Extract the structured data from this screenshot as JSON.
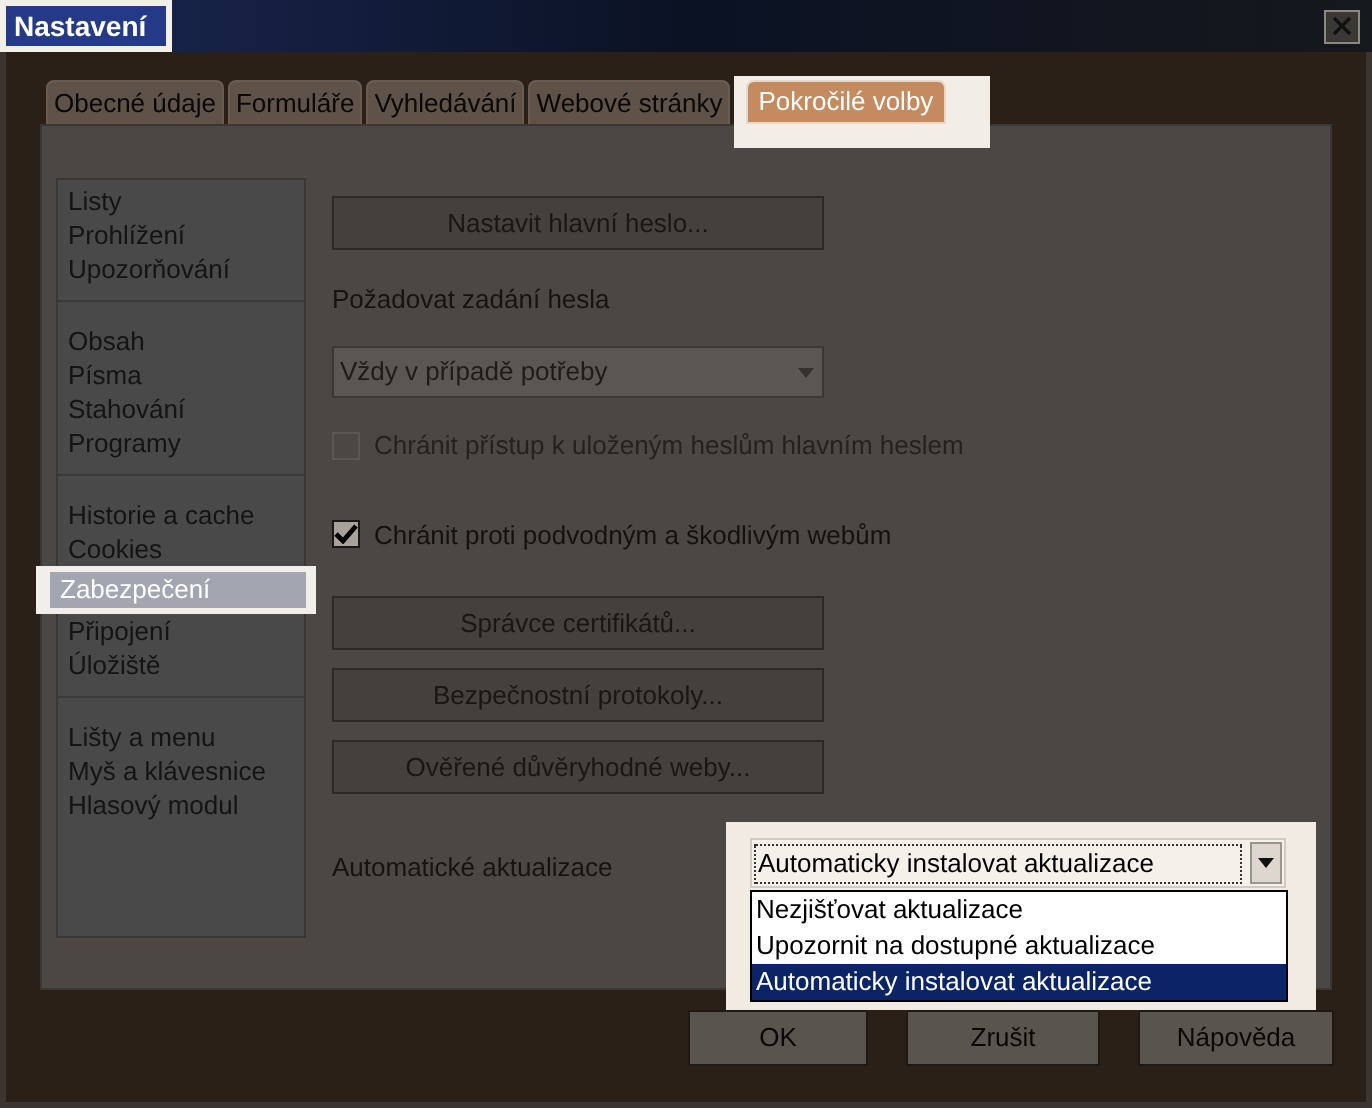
{
  "window": {
    "title": "Nastavení",
    "highlighted": true
  },
  "tabs": [
    {
      "label": "Obecné údaje",
      "selected": false
    },
    {
      "label": "Formuláře",
      "selected": false
    },
    {
      "label": "Vyhledávání",
      "selected": false
    },
    {
      "label": "Webové stránky",
      "selected": false
    },
    {
      "label": "Pokročilé volby",
      "selected": true
    }
  ],
  "sidebar": {
    "groups": [
      {
        "items": [
          {
            "label": "Listy",
            "selected": false
          },
          {
            "label": "Prohlížení",
            "selected": false
          },
          {
            "label": "Upozorňování",
            "selected": false
          }
        ]
      },
      {
        "items": [
          {
            "label": "Obsah",
            "selected": false
          },
          {
            "label": "Písma",
            "selected": false
          },
          {
            "label": "Stahování",
            "selected": false
          },
          {
            "label": "Programy",
            "selected": false
          }
        ]
      },
      {
        "items": [
          {
            "label": "Historie a cache",
            "selected": false
          },
          {
            "label": "Cookies",
            "selected": false
          },
          {
            "label": "Zabezpečení",
            "selected": true
          },
          {
            "label": "Připojení",
            "selected": false
          },
          {
            "label": "Úložiště",
            "selected": false
          }
        ]
      },
      {
        "items": [
          {
            "label": "Lišty a menu",
            "selected": false
          },
          {
            "label": "Myš a klávesnice",
            "selected": false
          },
          {
            "label": "Hlasový modul",
            "selected": false
          }
        ]
      }
    ]
  },
  "security": {
    "master_password_button": "Nastavit hlavní heslo...",
    "require_password_label": "Požadovat zadání hesla",
    "require_password_select": {
      "value": "Vždy v případě potřeby",
      "disabled": true
    },
    "checkboxes": [
      {
        "label": "Chránit přístup k uloženým heslům hlavním heslem",
        "checked": false,
        "disabled": true
      },
      {
        "label": "Chránit proti podvodným a škodlivým webům",
        "checked": true,
        "disabled": false
      }
    ],
    "buttons": [
      "Správce certifikátů...",
      "Bezpečnostní protokoly...",
      "Ověřené důvěryhodné weby..."
    ],
    "auto_updates": {
      "label": "Automatické aktualizace",
      "value": "Automaticky instalovat aktualizace",
      "expanded": true,
      "highlighted": true,
      "options": [
        {
          "label": "Nezjišťovat aktualizace",
          "selected": false
        },
        {
          "label": "Upozornit na dostupné aktualizace",
          "selected": false
        },
        {
          "label": "Automaticky instalovat aktualizace",
          "selected": true
        }
      ]
    }
  },
  "dialog_buttons": [
    "OK",
    "Zrušit",
    "Nápověda"
  ]
}
